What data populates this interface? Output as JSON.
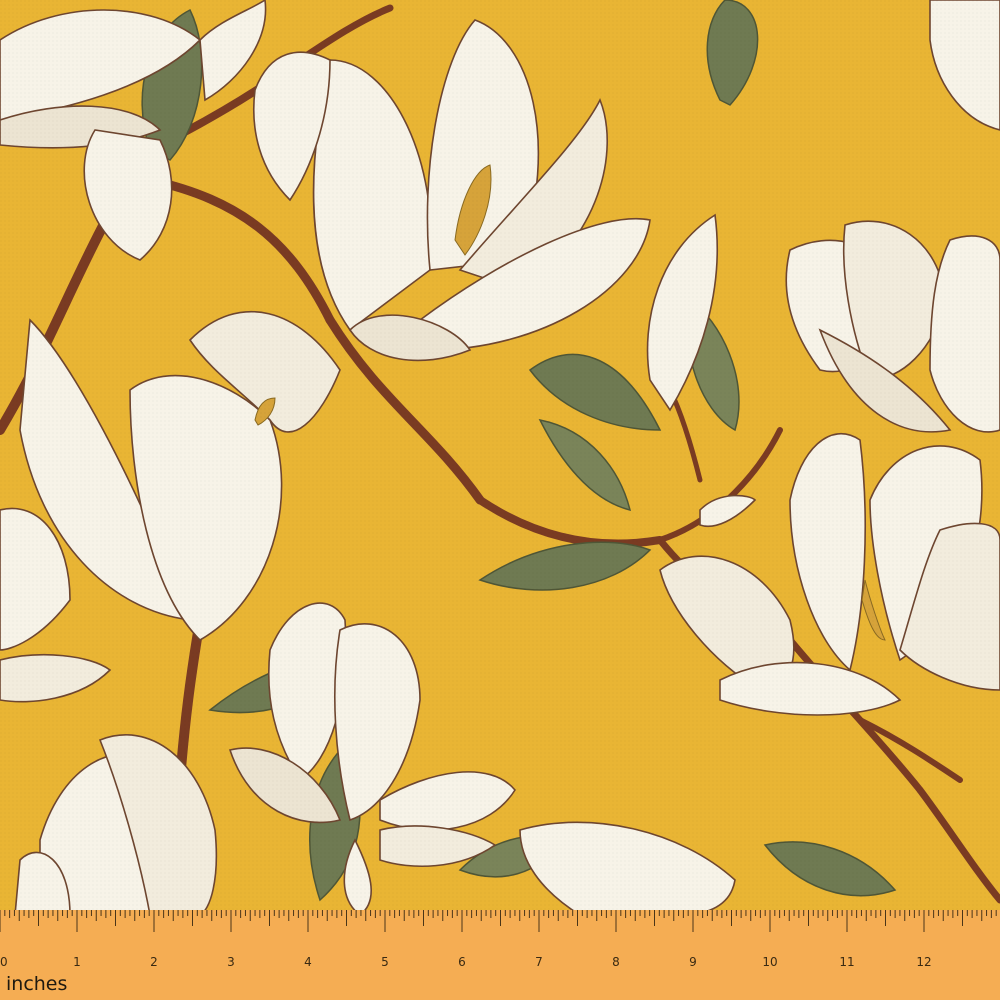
{
  "scene": {
    "description_role": "decorative fabric swatch",
    "colors": {
      "background": "#e9b534",
      "petal": "#f7f3e8",
      "petal_shadow": "#ece4d2",
      "outline": "#6e4630",
      "branch": "#7a3b22",
      "leaf": "#6f7a52",
      "leaf_light": "#8a9368",
      "stamen": "#d6a33a",
      "ruler": "#f5ad53"
    },
    "icons": [
      "magnolia-flower",
      "leaf",
      "branch"
    ]
  },
  "ruler": {
    "unit_label": "inches",
    "ticks": [
      "0",
      "1",
      "2",
      "3",
      "4",
      "5",
      "6",
      "7",
      "8",
      "9",
      "10",
      "11",
      "12",
      "1"
    ]
  }
}
